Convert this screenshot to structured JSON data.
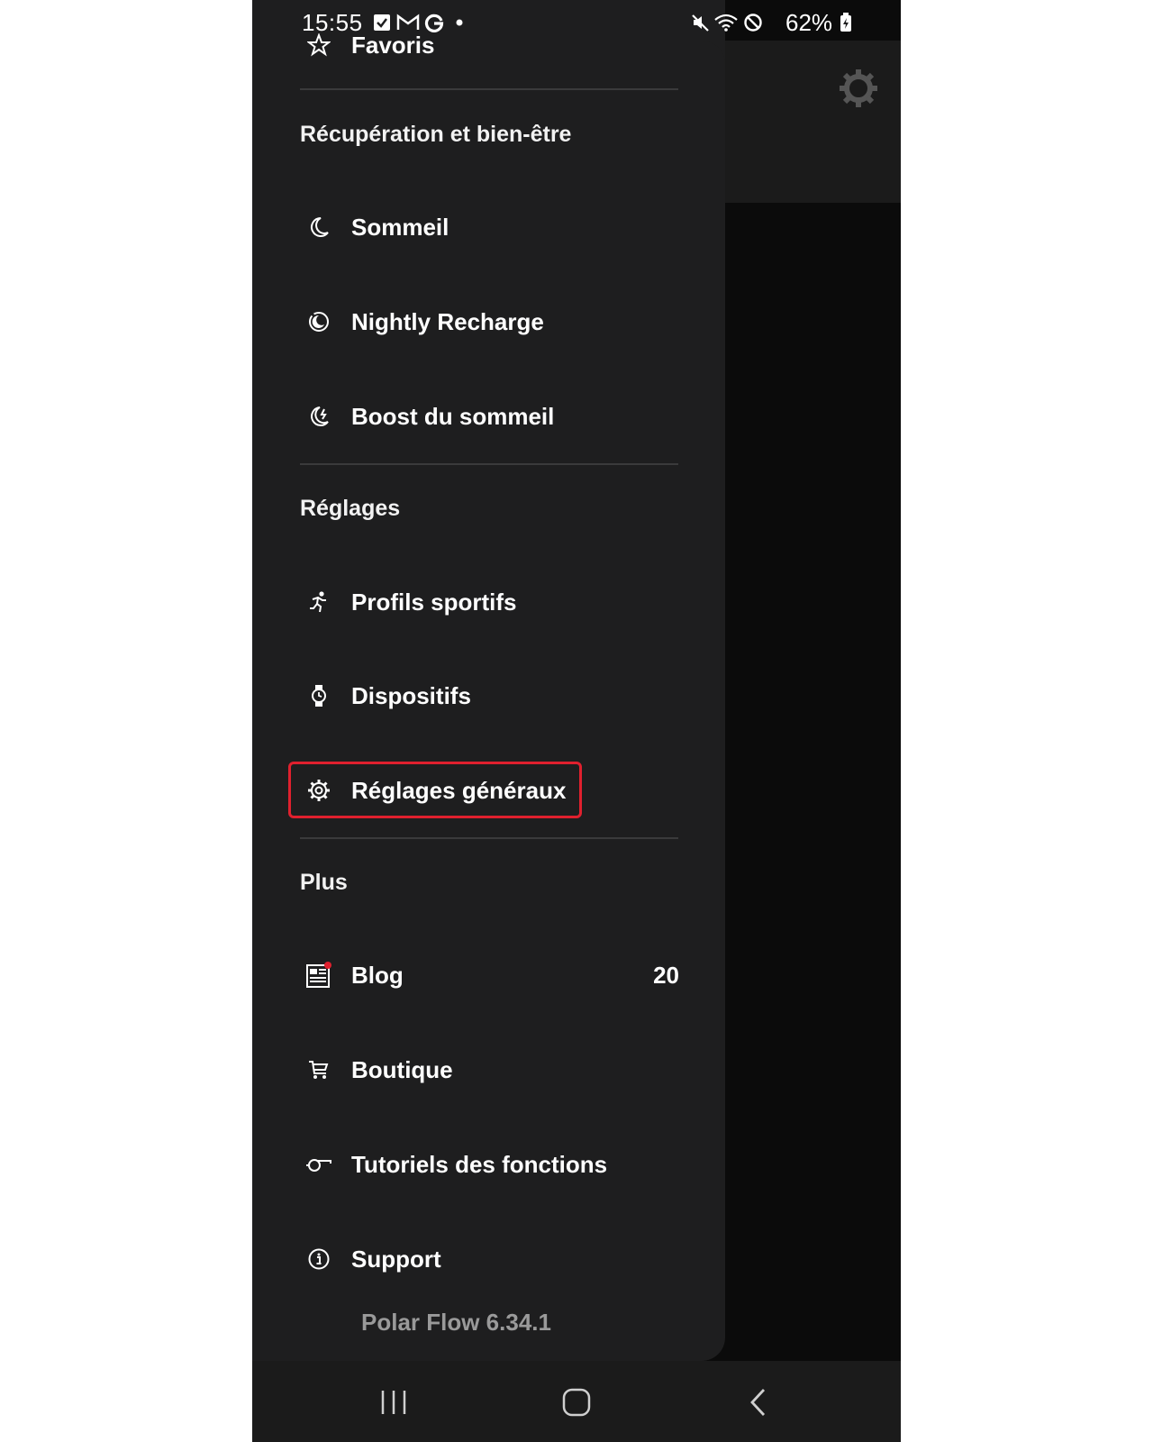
{
  "status_bar": {
    "time": "15:55",
    "battery": "62%"
  },
  "drawer": {
    "partial_item": {
      "label": "Favoris",
      "icon": "star-icon"
    },
    "sections": [
      {
        "title": "Récupération et bien-être",
        "items": [
          {
            "label": "Sommeil",
            "icon": "moon-icon"
          },
          {
            "label": "Nightly Recharge",
            "icon": "recharge-icon"
          },
          {
            "label": "Boost du sommeil",
            "icon": "sleep-boost-icon"
          }
        ]
      },
      {
        "title": "Réglages",
        "items": [
          {
            "label": "Profils sportifs",
            "icon": "runner-icon"
          },
          {
            "label": "Dispositifs",
            "icon": "watch-icon"
          },
          {
            "label": "Réglages généraux",
            "icon": "gear-icon",
            "highlighted": true
          }
        ]
      },
      {
        "title": "Plus",
        "items": [
          {
            "label": "Blog",
            "icon": "blog-icon",
            "badge": "20"
          },
          {
            "label": "Boutique",
            "icon": "cart-icon"
          },
          {
            "label": "Tutoriels des fonctions",
            "icon": "whistle-icon"
          },
          {
            "label": "Support",
            "icon": "info-icon"
          }
        ]
      }
    ],
    "version": "Polar Flow 6.34.1"
  },
  "colors": {
    "drawer_bg": "#1e1e1f",
    "highlight": "#e0202e",
    "notification_dot": "#e0202e"
  }
}
